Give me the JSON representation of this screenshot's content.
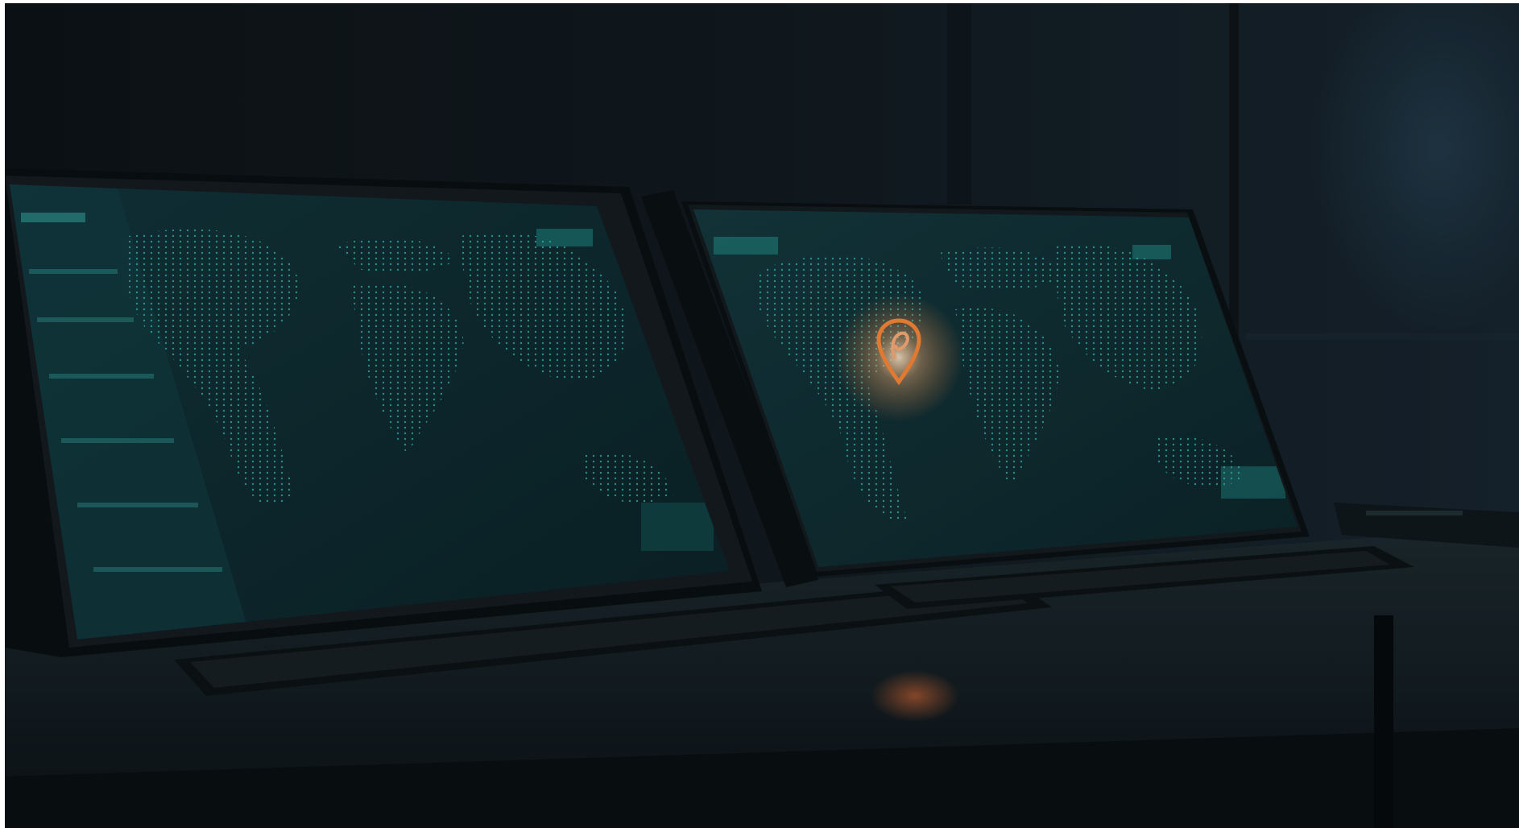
{
  "scene": {
    "subject": "",
    "accent_color": "#34d6cc",
    "pin_color": "#ff8a3a"
  },
  "left_monitor": {
    "map": "world-map",
    "dot_color": "#2fc9bd"
  },
  "right_monitor": {
    "map": "world-map",
    "marker": "location-pin-icon",
    "dot_color": "#2fc9bd"
  }
}
